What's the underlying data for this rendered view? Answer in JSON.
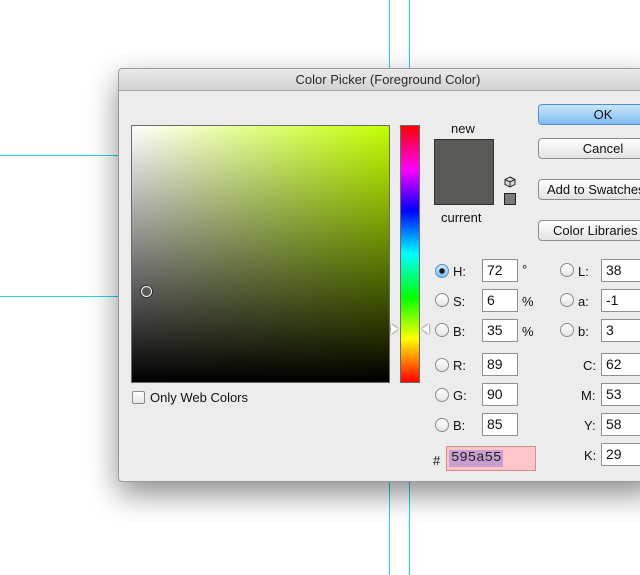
{
  "window": {
    "title": "Color Picker (Foreground Color)"
  },
  "colors": {
    "new": "#595a55",
    "current": "#595a55",
    "hue_pure": "#c3ff00",
    "ok_blue": "#7fbdf4",
    "hex_highlight": "#ffc6c9"
  },
  "preview": {
    "new_label": "new",
    "current_label": "current"
  },
  "buttons": {
    "ok": "OK",
    "cancel": "Cancel",
    "add_to_swatches": "Add to Swatches",
    "color_libraries": "Color Libraries"
  },
  "options": {
    "only_web_colors": "Only Web Colors"
  },
  "hsb": {
    "h": {
      "label": "H:",
      "value": "72",
      "unit": "°"
    },
    "s": {
      "label": "S:",
      "value": "6",
      "unit": "%"
    },
    "b": {
      "label": "B:",
      "value": "35",
      "unit": "%"
    }
  },
  "rgb": {
    "r": {
      "label": "R:",
      "value": "89"
    },
    "g": {
      "label": "G:",
      "value": "90"
    },
    "b": {
      "label": "B:",
      "value": "85"
    }
  },
  "lab": {
    "l": {
      "label": "L:",
      "value": "38"
    },
    "a": {
      "label": "a:",
      "value": "-1"
    },
    "b": {
      "label": "b:",
      "value": "3"
    }
  },
  "cmyk": {
    "c": {
      "label": "C:",
      "value": "62"
    },
    "m": {
      "label": "M:",
      "value": "53"
    },
    "y": {
      "label": "Y:",
      "value": "58"
    },
    "k": {
      "label": "K:",
      "value": "29"
    }
  },
  "hex": {
    "prefix": "#",
    "value": "595a55"
  }
}
